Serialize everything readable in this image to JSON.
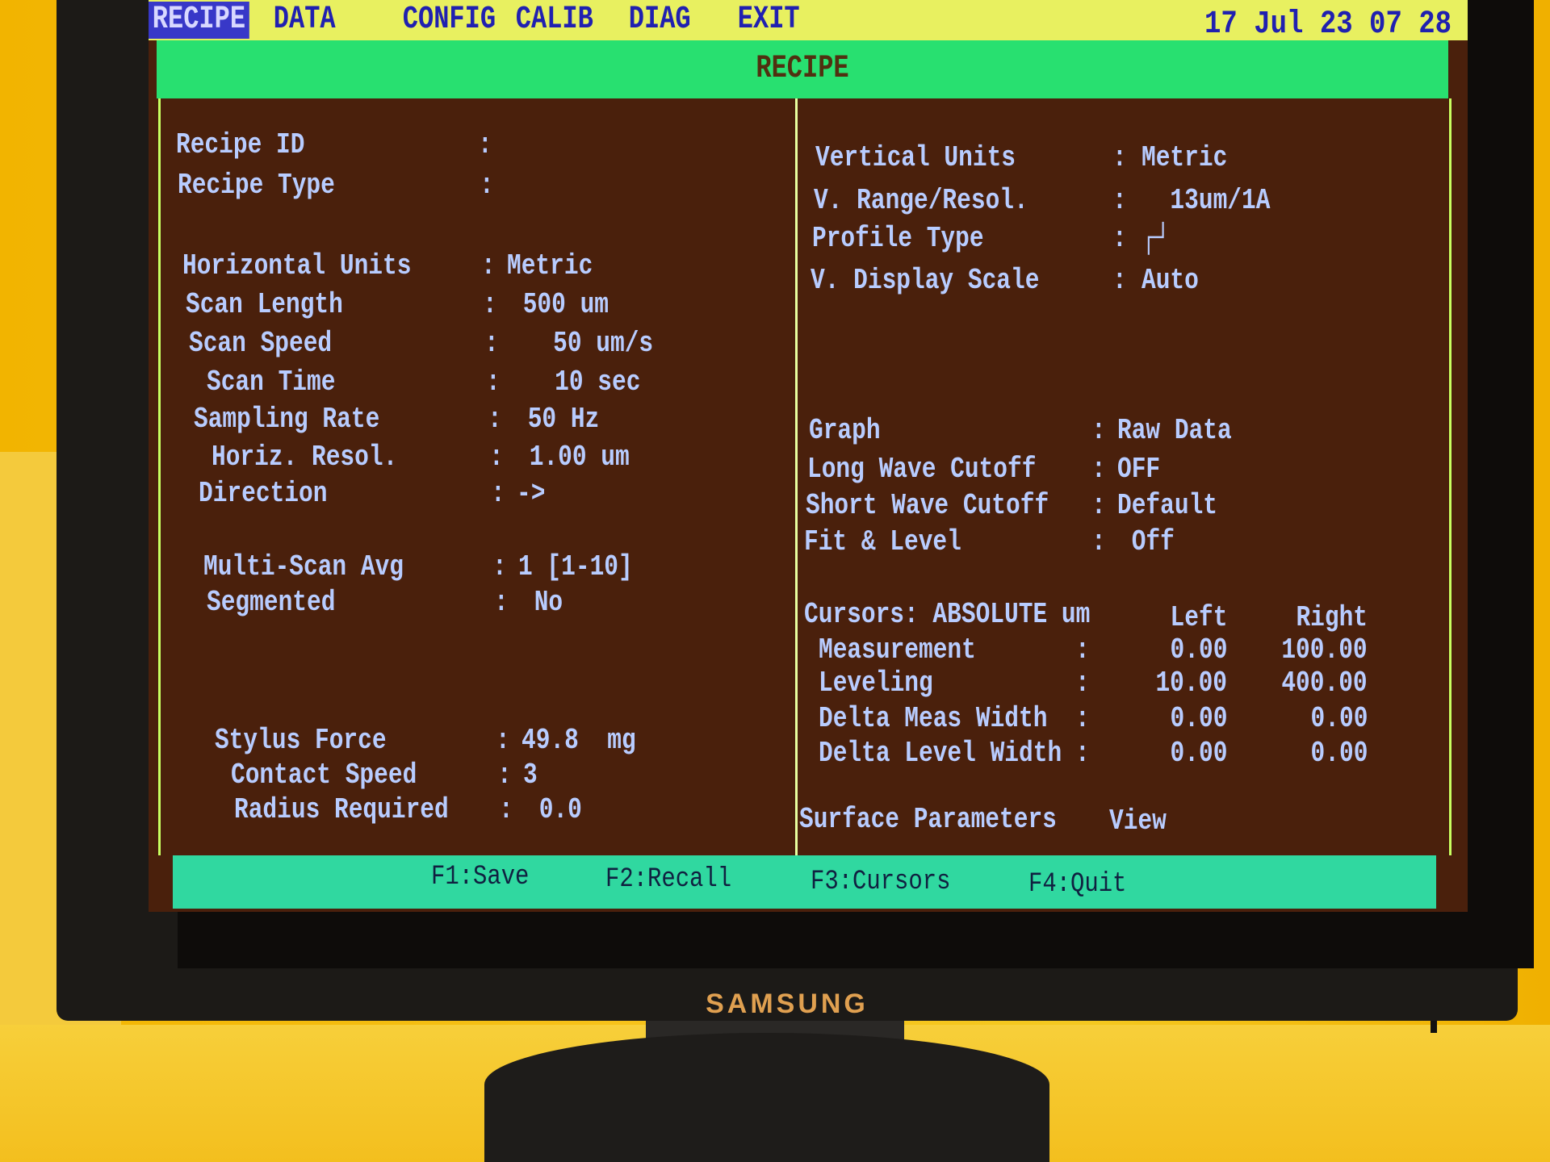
{
  "menu": {
    "items": [
      "RECIPE",
      "DATA",
      "CONFIG",
      "CALIB",
      "DIAG",
      "EXIT"
    ],
    "active": "RECIPE",
    "clock": "17 Jul 23 07 28"
  },
  "title": "RECIPE",
  "left": [
    {
      "label": "Recipe ID",
      "value": ""
    },
    {
      "label": "Recipe Type",
      "value": ""
    },
    {
      "label": "Horizontal Units",
      "value": "Metric"
    },
    {
      "label": "Scan Length",
      "value": " 500 um"
    },
    {
      "label": "Scan Speed",
      "value": "   50 um/s"
    },
    {
      "label": "Scan Time",
      "value": "   10 sec"
    },
    {
      "label": "Sampling Rate",
      "value": " 50 Hz"
    },
    {
      "label": "Horiz. Resol.",
      "value": " 1.00 um"
    },
    {
      "label": "Direction",
      "value": "->"
    },
    {
      "label": "Multi-Scan Avg",
      "value": "1 [1-10]"
    },
    {
      "label": "Segmented",
      "value": " No"
    },
    {
      "label": "Stylus Force",
      "value": "49.8  mg"
    },
    {
      "label": "Contact Speed",
      "value": "3"
    },
    {
      "label": "Radius Required",
      "value": " 0.0"
    }
  ],
  "right": [
    {
      "label": "Vertical Units",
      "value": "Metric"
    },
    {
      "label": "V. Range/Resol.",
      "value": "  13um/1A"
    },
    {
      "label": "Profile Type",
      "value": "┌┘",
      "icon": "step-profile-icon"
    },
    {
      "label": "V. Display Scale",
      "value": "Auto"
    },
    {
      "label": "Graph",
      "value": "Raw Data"
    },
    {
      "label": "Long Wave Cutoff",
      "value": "OFF"
    },
    {
      "label": "Short Wave Cutoff",
      "value": "Default"
    },
    {
      "label": "Fit & Level",
      "value": " Off"
    }
  ],
  "cursors": {
    "header": "Cursors: ABSOLUTE um",
    "col_left": "Left",
    "col_right": "Right",
    "rows": [
      {
        "label": "Measurement",
        "left": "0.00",
        "right": "100.00"
      },
      {
        "label": "Leveling",
        "left": "10.00",
        "right": "400.00"
      },
      {
        "label": "Delta Meas Width",
        "left": "0.00",
        "right": "0.00"
      },
      {
        "label": "Delta Level Width",
        "left": "0.00",
        "right": "0.00"
      }
    ]
  },
  "surface": {
    "label": "Surface Parameters",
    "value": "View"
  },
  "function_keys": [
    "F1:Save",
    "F2:Recall",
    "F3:Cursors",
    "F4:Quit"
  ],
  "monitor_brand": "SAMSUNG",
  "colors": {
    "menubar": "#e8f060",
    "titlebar": "#28e070",
    "screen": "#4a200c",
    "text": "#b8ccff",
    "fbar": "#30d8a0"
  }
}
